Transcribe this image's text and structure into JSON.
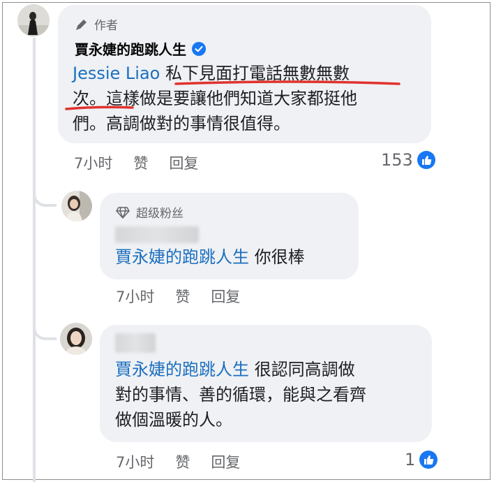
{
  "comment_main": {
    "badge": "作者",
    "author": "賈永婕的跑跳人生",
    "mention": "Jessie Liao",
    "text_line1": " 私下見面打電話無數無數",
    "text_line2": "次。這樣做是要讓他們知道大家都挺他",
    "text_line3": "們。高調做對的事情很值得。",
    "time": "7小时",
    "like_label": "赞",
    "reply_label": "回复",
    "reaction_count": "153"
  },
  "reply1": {
    "badge": "超级粉丝",
    "mention": "賈永婕的跑跳人生",
    "text": " 你很棒",
    "time": "7小时",
    "like_label": "赞",
    "reply_label": "回复"
  },
  "reply2": {
    "mention": "賈永婕的跑跳人生",
    "text_line1": " 很認同高調做",
    "text_line2": "對的事情、善的循環，能與之看齊",
    "text_line3": "做個溫暖的人。",
    "time": "7小时",
    "like_label": "赞",
    "reply_label": "回复",
    "reaction_count": "1"
  },
  "colors": {
    "mention": "#1c6fbf",
    "like": "#1877f2",
    "underline": "#e0322d",
    "bubble": "#eff1f4"
  },
  "icons": [
    "pen-icon",
    "verified-icon",
    "diamond-icon",
    "like-icon"
  ]
}
